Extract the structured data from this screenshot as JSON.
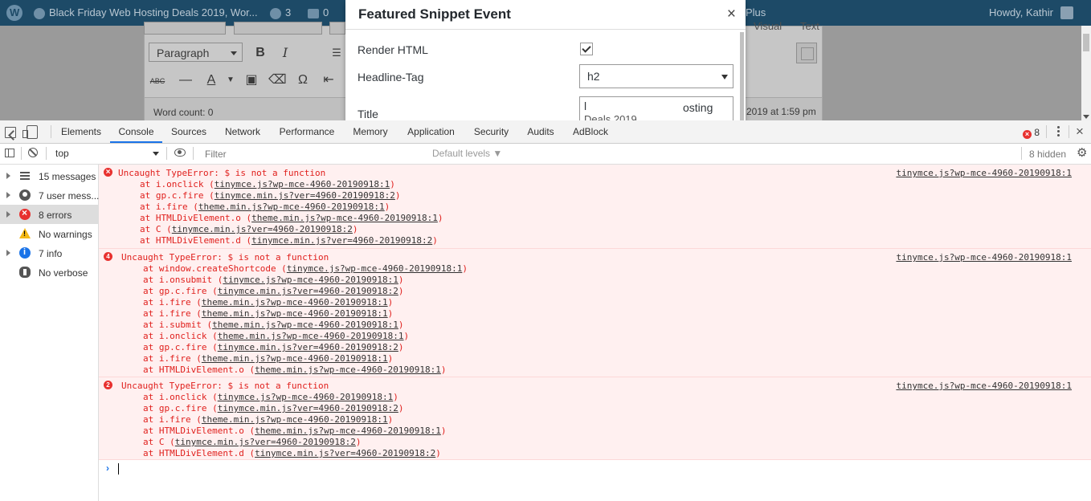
{
  "wp": {
    "admin_bar": {
      "site_title": "Black Friday Web Hosting Deals 2019, Wor...",
      "updates_count": "3",
      "comments_count": "0",
      "plus_label": "Plus",
      "howdy": "Howdy, Kathir"
    },
    "editor": {
      "tab_visual": "Visual",
      "tab_text": "Text",
      "format_value": "Paragraph",
      "word_count": "Word count: 0",
      "saved_at": "2019 at 1:59 pm"
    },
    "modal": {
      "title": "Featured Snippet Event",
      "close": "×",
      "render_html_label": "Render HTML",
      "render_html_checked": true,
      "headline_tag_label": "Headline-Tag",
      "headline_tag_value": "h2",
      "title_label": "Title",
      "title_value_line1": "l",
      "title_value_tail": "osting",
      "title_value_line2": "Deals 2019"
    }
  },
  "devtools": {
    "tabs": [
      "Elements",
      "Console",
      "Sources",
      "Network",
      "Performance",
      "Memory",
      "Application",
      "Security",
      "Audits",
      "AdBlock"
    ],
    "active_tab": "Console",
    "error_badge_count": "8",
    "close": "×",
    "toolbar": {
      "context": "top",
      "filter_placeholder": "Filter",
      "levels": "Default levels ▼",
      "hidden_count": "8 hidden"
    },
    "sidebar": [
      {
        "label": "15 messages",
        "icon": "list-icon",
        "expandable": true,
        "active": false
      },
      {
        "label": "7 user mess...",
        "icon": "user-icon",
        "expandable": true,
        "active": false
      },
      {
        "label": "8 errors",
        "icon": "error-icon",
        "expandable": true,
        "active": true
      },
      {
        "label": "No warnings",
        "icon": "warning-icon",
        "expandable": false,
        "active": false
      },
      {
        "label": "7 info",
        "icon": "info-icon",
        "expandable": true,
        "active": false
      },
      {
        "label": "No verbose",
        "icon": "bug-icon",
        "expandable": false,
        "active": false
      }
    ],
    "messages": [
      {
        "count": "",
        "text": "Uncaught TypeError: $ is not a function",
        "source": "tinymce.js?wp-mce-4960-20190918:1",
        "stack": [
          {
            "fn": "at i.onclick (",
            "src": "tinymce.js?wp-mce-4960-20190918:1",
            "end": ")"
          },
          {
            "fn": "at gp.c.fire (",
            "src": "tinymce.min.js?ver=4960-20190918:2",
            "end": ")"
          },
          {
            "fn": "at i.fire (",
            "src": "theme.min.js?wp-mce-4960-20190918:1",
            "end": ")"
          },
          {
            "fn": "at HTMLDivElement.o (",
            "src": "theme.min.js?wp-mce-4960-20190918:1",
            "end": ")"
          },
          {
            "fn": "at C (",
            "src": "tinymce.min.js?ver=4960-20190918:2",
            "end": ")"
          },
          {
            "fn": "at HTMLDivElement.d (",
            "src": "tinymce.min.js?ver=4960-20190918:2",
            "end": ")"
          }
        ]
      },
      {
        "count": "4",
        "text": "Uncaught TypeError: $ is not a function",
        "source": "tinymce.js?wp-mce-4960-20190918:1",
        "stack": [
          {
            "fn": "at window.createShortcode (",
            "src": "tinymce.js?wp-mce-4960-20190918:1",
            "end": ")"
          },
          {
            "fn": "at i.onsubmit (",
            "src": "tinymce.js?wp-mce-4960-20190918:1",
            "end": ")"
          },
          {
            "fn": "at gp.c.fire (",
            "src": "tinymce.min.js?ver=4960-20190918:2",
            "end": ")"
          },
          {
            "fn": "at i.fire (",
            "src": "theme.min.js?wp-mce-4960-20190918:1",
            "end": ")"
          },
          {
            "fn": "at i.fire (",
            "src": "theme.min.js?wp-mce-4960-20190918:1",
            "end": ")"
          },
          {
            "fn": "at i.submit (",
            "src": "theme.min.js?wp-mce-4960-20190918:1",
            "end": ")"
          },
          {
            "fn": "at i.onclick (",
            "src": "theme.min.js?wp-mce-4960-20190918:1",
            "end": ")"
          },
          {
            "fn": "at gp.c.fire (",
            "src": "tinymce.min.js?ver=4960-20190918:2",
            "end": ")"
          },
          {
            "fn": "at i.fire (",
            "src": "theme.min.js?wp-mce-4960-20190918:1",
            "end": ")"
          },
          {
            "fn": "at HTMLDivElement.o (",
            "src": "theme.min.js?wp-mce-4960-20190918:1",
            "end": ")"
          }
        ]
      },
      {
        "count": "2",
        "text": "Uncaught TypeError: $ is not a function",
        "source": "tinymce.js?wp-mce-4960-20190918:1",
        "stack": [
          {
            "fn": "at i.onclick (",
            "src": "tinymce.js?wp-mce-4960-20190918:1",
            "end": ")"
          },
          {
            "fn": "at gp.c.fire (",
            "src": "tinymce.min.js?ver=4960-20190918:2",
            "end": ")"
          },
          {
            "fn": "at i.fire (",
            "src": "theme.min.js?wp-mce-4960-20190918:1",
            "end": ")"
          },
          {
            "fn": "at HTMLDivElement.o (",
            "src": "theme.min.js?wp-mce-4960-20190918:1",
            "end": ")"
          },
          {
            "fn": "at C (",
            "src": "tinymce.min.js?ver=4960-20190918:2",
            "end": ")"
          },
          {
            "fn": "at HTMLDivElement.d (",
            "src": "tinymce.min.js?ver=4960-20190918:2",
            "end": ")"
          }
        ]
      }
    ]
  }
}
